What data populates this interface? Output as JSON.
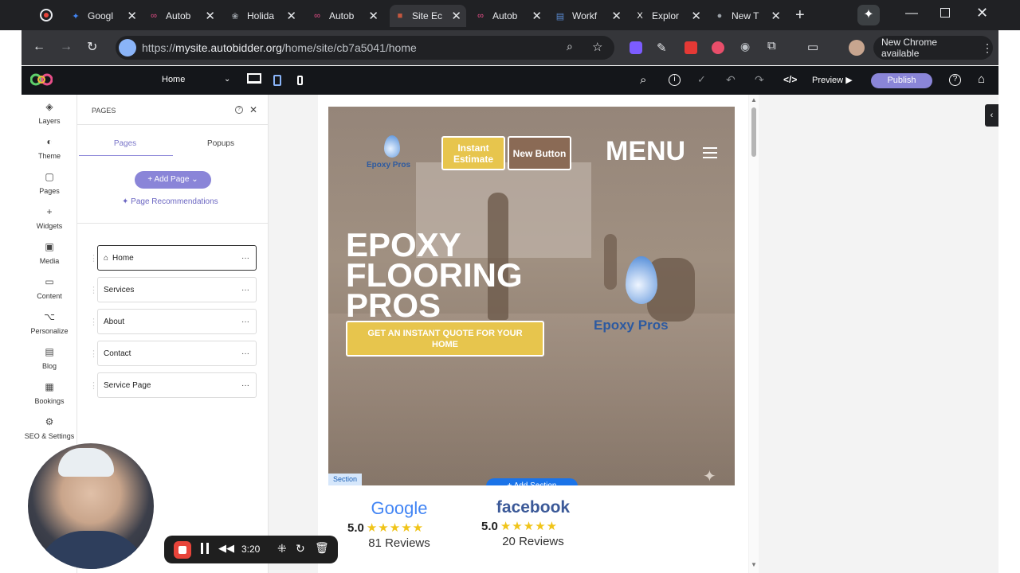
{
  "tabs": [
    {
      "title": "Googl",
      "color": "#4285f4",
      "glyph": "✦"
    },
    {
      "title": "Autob",
      "color": "#e84e89",
      "glyph": "∞"
    },
    {
      "title": "Holida",
      "color": "#9aa0a6",
      "glyph": "❀"
    },
    {
      "title": "Autob",
      "color": "#e84e89",
      "glyph": "∞"
    },
    {
      "title": "Site Ec",
      "color": "#c4573f",
      "glyph": "■"
    },
    {
      "title": "Autob",
      "color": "#e84e89",
      "glyph": "∞"
    },
    {
      "title": "Workf",
      "color": "#5b8dd6",
      "glyph": "▤"
    },
    {
      "title": "Explor",
      "color": "#ffffff",
      "glyph": "X"
    },
    {
      "title": "New T",
      "color": "#9aa0a6",
      "glyph": "●"
    }
  ],
  "browser": {
    "url_prefix": "https://",
    "url_host": "mysite.autobidder.org",
    "url_path": "/home/site/cb7a5041/home",
    "update_label": "New Chrome available"
  },
  "editor": {
    "page_select": "Home",
    "preview_label": "Preview",
    "publish_label": "Publish"
  },
  "sidebar": [
    {
      "label": "Layers",
      "icon": "layers-icon",
      "glyph": "◈"
    },
    {
      "label": "Theme",
      "icon": "palette-icon",
      "glyph": "◐"
    },
    {
      "label": "Pages",
      "icon": "pages-icon",
      "glyph": "▢"
    },
    {
      "label": "Widgets",
      "icon": "plus-icon",
      "glyph": "+"
    },
    {
      "label": "Media",
      "icon": "image-icon",
      "glyph": "▣"
    },
    {
      "label": "Content",
      "icon": "folder-icon",
      "glyph": "▭"
    },
    {
      "label": "Personalize",
      "icon": "personalize-icon",
      "glyph": "⌥"
    },
    {
      "label": "Blog",
      "icon": "blog-icon",
      "glyph": "▤"
    },
    {
      "label": "Bookings",
      "icon": "calendar-icon",
      "glyph": "▦"
    },
    {
      "label": "SEO & Settings",
      "icon": "gear-icon",
      "glyph": "⚙"
    }
  ],
  "pages_panel": {
    "title": "PAGES",
    "tab_pages": "Pages",
    "tab_popups": "Popups",
    "add_page": "Add Page",
    "recommendations": "Page Recommendations",
    "pages": [
      "Home",
      "Services",
      "About",
      "Contact",
      "Service Page"
    ]
  },
  "site": {
    "logo_text": "Epoxy Pros",
    "btn_estimate": "Instant Estimate",
    "btn_new": "New Button",
    "menu": "MENU",
    "hero_title_1": "EPOXY",
    "hero_title_2": "FLOORING",
    "hero_title_3": "PROS",
    "cta": "GET AN INSTANT QUOTE FOR YOUR HOME",
    "section_tag": "Section",
    "add_section": "+ Add Section",
    "google_label": "Google",
    "google_rating": "5.0",
    "google_reviews": "81 Reviews",
    "facebook_label": "facebook",
    "facebook_rating": "5.0",
    "facebook_reviews": "20 Reviews"
  },
  "recorder": {
    "time": "3:20"
  },
  "colors": {
    "accent": "#8a85d8",
    "gold": "#e7c54d",
    "brown": "#8a6a55"
  }
}
